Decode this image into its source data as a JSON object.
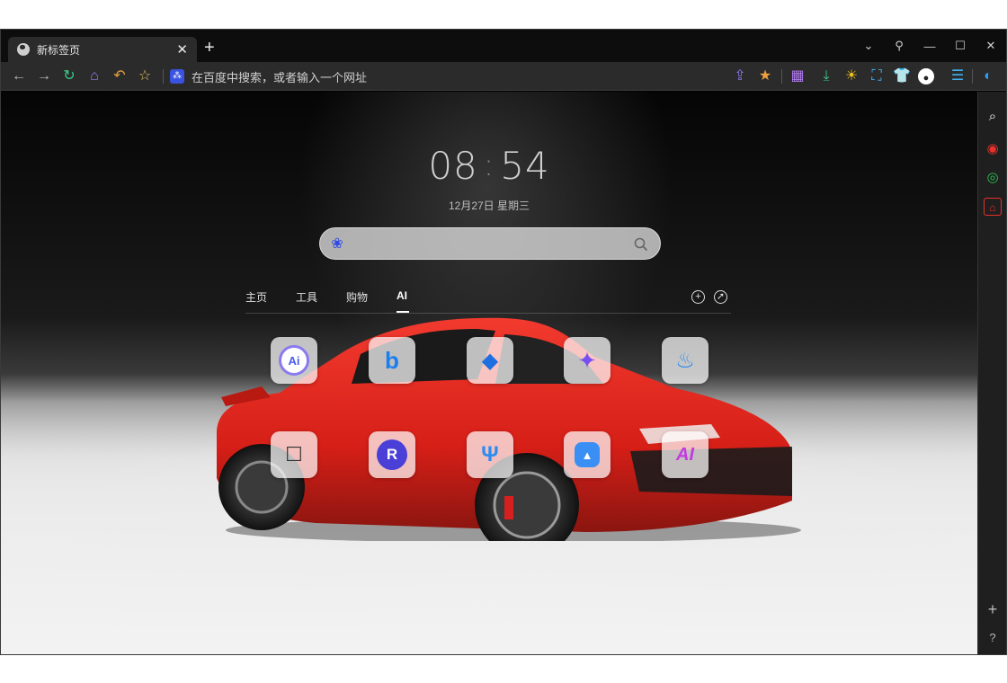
{
  "browser": {
    "tab_title": "新标签页",
    "tab_close": "✕",
    "new_tab": "+",
    "window_controls": [
      "⌄",
      "⚲",
      "—",
      "☐",
      "✕"
    ],
    "address_placeholder": "在百度中搜索，或者输入一个网址"
  },
  "newtab": {
    "clock": {
      "hour": "08",
      "sep": ":",
      "minute": "54"
    },
    "date": "12月27日 星期三",
    "search_placeholder": "",
    "tabs": [
      {
        "label": "主页"
      },
      {
        "label": "工具"
      },
      {
        "label": "购物"
      },
      {
        "label": "AI"
      }
    ],
    "active_tab": "AI"
  },
  "apps_row1": [
    {
      "icon": "ai-assistant-icon",
      "glyph": "Ai",
      "color": "#6b5cff"
    },
    {
      "icon": "bing-icon",
      "glyph": "b",
      "color": "#1a7df0"
    },
    {
      "icon": "cube-ai-icon",
      "glyph": "◆",
      "color": "#1f6fe0"
    },
    {
      "icon": "star-knot-icon",
      "glyph": "✦",
      "color": "#7a4ff0"
    },
    {
      "icon": "flame-drop-icon",
      "glyph": "♨",
      "color": "#2a8cf0"
    }
  ],
  "apps_row2": [
    {
      "icon": "robot-icon",
      "glyph": "☐",
      "color": "#333333"
    },
    {
      "icon": "r-logo-icon",
      "glyph": "R",
      "color": "#4a3fd6"
    },
    {
      "icon": "tree-icon",
      "glyph": "Ψ",
      "color": "#2c8cf0"
    },
    {
      "icon": "triangle-a-icon",
      "glyph": "▲",
      "color": "#3a8ff5"
    },
    {
      "icon": "ai-gradient-icon",
      "glyph": "AI",
      "color": "#c43ae0"
    }
  ],
  "colors": {
    "baidu_blue": "#2f4be6",
    "red_accent": "#e8322a"
  }
}
